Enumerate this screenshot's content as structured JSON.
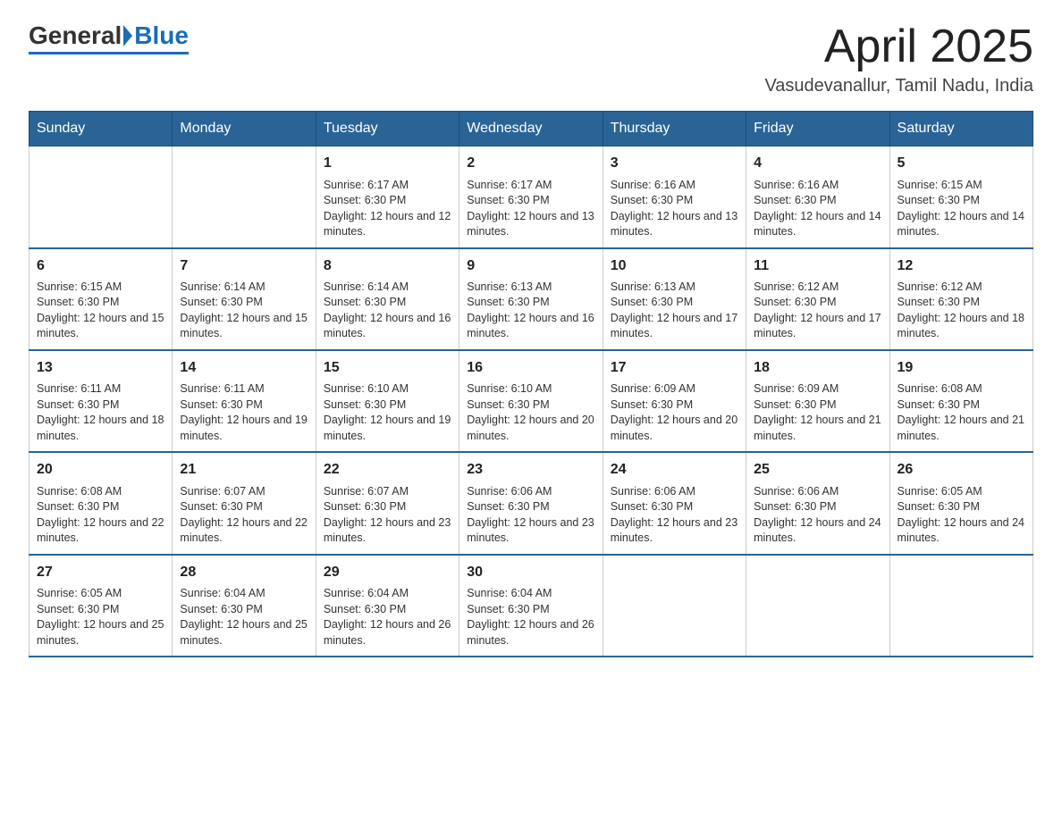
{
  "header": {
    "logo_general": "General",
    "logo_blue": "Blue",
    "title": "April 2025",
    "subtitle": "Vasudevanallur, Tamil Nadu, India"
  },
  "weekdays": [
    "Sunday",
    "Monday",
    "Tuesday",
    "Wednesday",
    "Thursday",
    "Friday",
    "Saturday"
  ],
  "weeks": [
    [
      {
        "day": "",
        "info": ""
      },
      {
        "day": "",
        "info": ""
      },
      {
        "day": "1",
        "info": "Sunrise: 6:17 AM\nSunset: 6:30 PM\nDaylight: 12 hours and 12 minutes."
      },
      {
        "day": "2",
        "info": "Sunrise: 6:17 AM\nSunset: 6:30 PM\nDaylight: 12 hours and 13 minutes."
      },
      {
        "day": "3",
        "info": "Sunrise: 6:16 AM\nSunset: 6:30 PM\nDaylight: 12 hours and 13 minutes."
      },
      {
        "day": "4",
        "info": "Sunrise: 6:16 AM\nSunset: 6:30 PM\nDaylight: 12 hours and 14 minutes."
      },
      {
        "day": "5",
        "info": "Sunrise: 6:15 AM\nSunset: 6:30 PM\nDaylight: 12 hours and 14 minutes."
      }
    ],
    [
      {
        "day": "6",
        "info": "Sunrise: 6:15 AM\nSunset: 6:30 PM\nDaylight: 12 hours and 15 minutes."
      },
      {
        "day": "7",
        "info": "Sunrise: 6:14 AM\nSunset: 6:30 PM\nDaylight: 12 hours and 15 minutes."
      },
      {
        "day": "8",
        "info": "Sunrise: 6:14 AM\nSunset: 6:30 PM\nDaylight: 12 hours and 16 minutes."
      },
      {
        "day": "9",
        "info": "Sunrise: 6:13 AM\nSunset: 6:30 PM\nDaylight: 12 hours and 16 minutes."
      },
      {
        "day": "10",
        "info": "Sunrise: 6:13 AM\nSunset: 6:30 PM\nDaylight: 12 hours and 17 minutes."
      },
      {
        "day": "11",
        "info": "Sunrise: 6:12 AM\nSunset: 6:30 PM\nDaylight: 12 hours and 17 minutes."
      },
      {
        "day": "12",
        "info": "Sunrise: 6:12 AM\nSunset: 6:30 PM\nDaylight: 12 hours and 18 minutes."
      }
    ],
    [
      {
        "day": "13",
        "info": "Sunrise: 6:11 AM\nSunset: 6:30 PM\nDaylight: 12 hours and 18 minutes."
      },
      {
        "day": "14",
        "info": "Sunrise: 6:11 AM\nSunset: 6:30 PM\nDaylight: 12 hours and 19 minutes."
      },
      {
        "day": "15",
        "info": "Sunrise: 6:10 AM\nSunset: 6:30 PM\nDaylight: 12 hours and 19 minutes."
      },
      {
        "day": "16",
        "info": "Sunrise: 6:10 AM\nSunset: 6:30 PM\nDaylight: 12 hours and 20 minutes."
      },
      {
        "day": "17",
        "info": "Sunrise: 6:09 AM\nSunset: 6:30 PM\nDaylight: 12 hours and 20 minutes."
      },
      {
        "day": "18",
        "info": "Sunrise: 6:09 AM\nSunset: 6:30 PM\nDaylight: 12 hours and 21 minutes."
      },
      {
        "day": "19",
        "info": "Sunrise: 6:08 AM\nSunset: 6:30 PM\nDaylight: 12 hours and 21 minutes."
      }
    ],
    [
      {
        "day": "20",
        "info": "Sunrise: 6:08 AM\nSunset: 6:30 PM\nDaylight: 12 hours and 22 minutes."
      },
      {
        "day": "21",
        "info": "Sunrise: 6:07 AM\nSunset: 6:30 PM\nDaylight: 12 hours and 22 minutes."
      },
      {
        "day": "22",
        "info": "Sunrise: 6:07 AM\nSunset: 6:30 PM\nDaylight: 12 hours and 23 minutes."
      },
      {
        "day": "23",
        "info": "Sunrise: 6:06 AM\nSunset: 6:30 PM\nDaylight: 12 hours and 23 minutes."
      },
      {
        "day": "24",
        "info": "Sunrise: 6:06 AM\nSunset: 6:30 PM\nDaylight: 12 hours and 23 minutes."
      },
      {
        "day": "25",
        "info": "Sunrise: 6:06 AM\nSunset: 6:30 PM\nDaylight: 12 hours and 24 minutes."
      },
      {
        "day": "26",
        "info": "Sunrise: 6:05 AM\nSunset: 6:30 PM\nDaylight: 12 hours and 24 minutes."
      }
    ],
    [
      {
        "day": "27",
        "info": "Sunrise: 6:05 AM\nSunset: 6:30 PM\nDaylight: 12 hours and 25 minutes."
      },
      {
        "day": "28",
        "info": "Sunrise: 6:04 AM\nSunset: 6:30 PM\nDaylight: 12 hours and 25 minutes."
      },
      {
        "day": "29",
        "info": "Sunrise: 6:04 AM\nSunset: 6:30 PM\nDaylight: 12 hours and 26 minutes."
      },
      {
        "day": "30",
        "info": "Sunrise: 6:04 AM\nSunset: 6:30 PM\nDaylight: 12 hours and 26 minutes."
      },
      {
        "day": "",
        "info": ""
      },
      {
        "day": "",
        "info": ""
      },
      {
        "day": "",
        "info": ""
      }
    ]
  ]
}
